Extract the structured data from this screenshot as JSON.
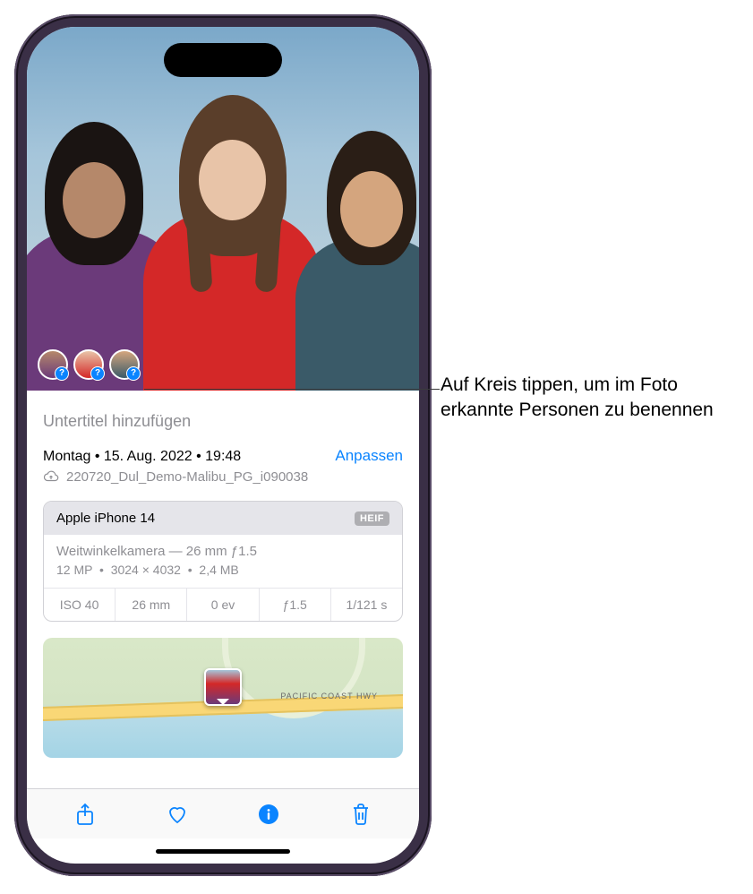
{
  "caption_placeholder": "Untertitel hinzufügen",
  "datetime": {
    "weekday": "Montag",
    "date": "15. Aug. 2022",
    "time": "19:48",
    "adjust": "Anpassen"
  },
  "filename": "220720_Dul_Demo-Malibu_PG_i090038",
  "exif": {
    "device": "Apple iPhone 14",
    "format_badge": "HEIF",
    "lens": "Weitwinkelkamera — 26 mm ƒ1.5",
    "resolution": "12 MP",
    "dimensions": "3024 × 4032",
    "filesize": "2,4 MB",
    "stats": {
      "iso": "ISO 40",
      "focal": "26 mm",
      "ev": "0 ev",
      "aperture": "ƒ1.5",
      "shutter": "1/121 s"
    }
  },
  "map": {
    "road_label": "PACIFIC COAST HWY"
  },
  "avatars": [
    {
      "badge": "?"
    },
    {
      "badge": "?"
    },
    {
      "badge": "?"
    }
  ],
  "callout": "Auf Kreis tippen, um im Foto erkannte Personen zu benennen"
}
